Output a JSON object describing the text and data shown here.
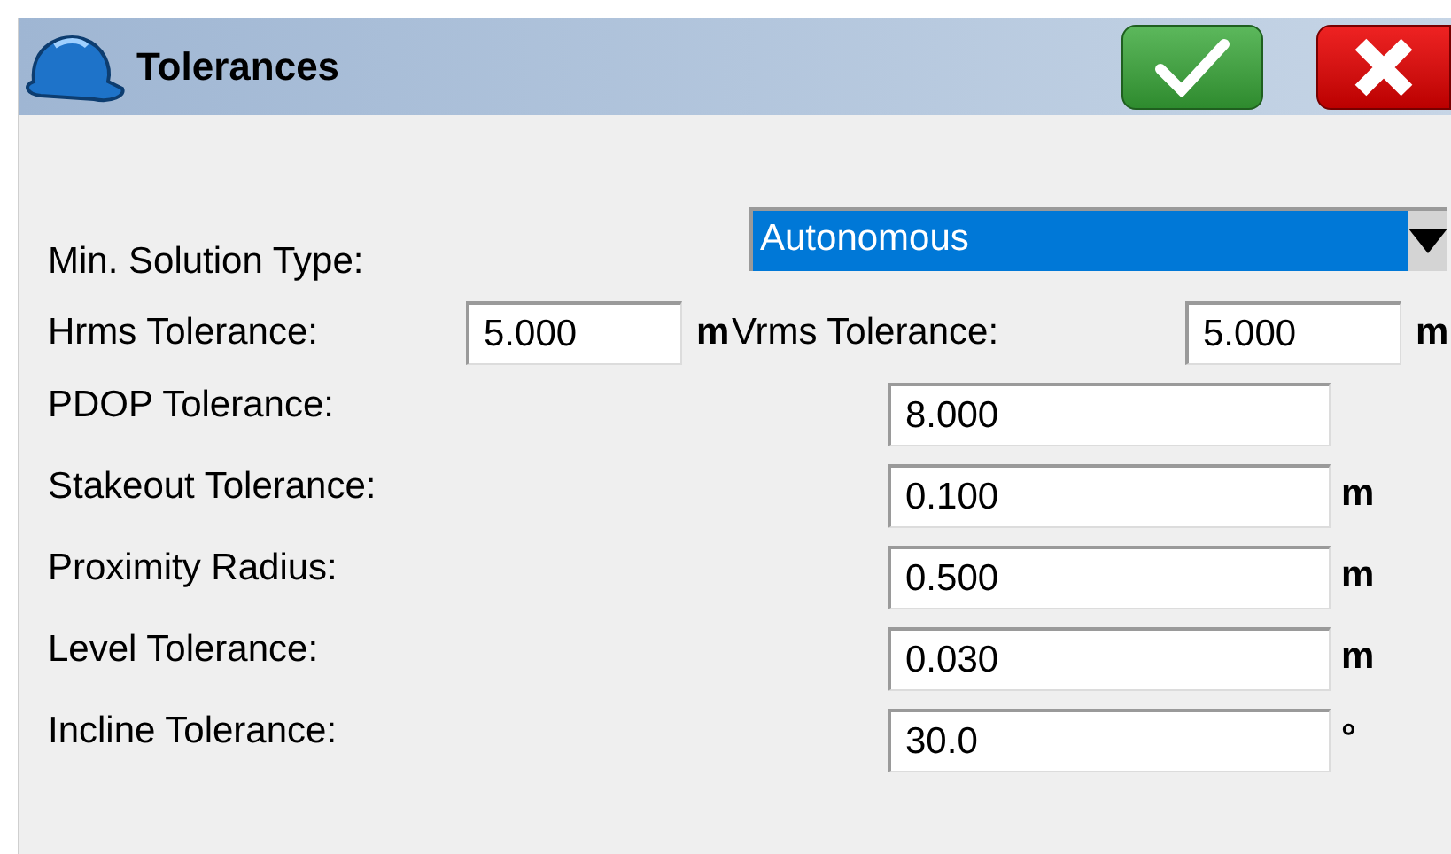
{
  "window": {
    "title": "Tolerances"
  },
  "solution_type": {
    "label": "Min. Solution Type:",
    "value": "Autonomous"
  },
  "rms": [
    {
      "label": "Hrms Tolerance:",
      "value": "5.000",
      "unit": "m"
    },
    {
      "label": "Vrms Tolerance:",
      "value": "5.000",
      "unit": "m"
    }
  ],
  "rows": [
    {
      "label": "PDOP Tolerance:",
      "value": "8.000"
    },
    {
      "label": "Stakeout Tolerance:",
      "value": "0.100",
      "unit": "m"
    },
    {
      "label": "Proximity Radius:",
      "value": "0.500",
      "unit": "m"
    },
    {
      "label": "Level Tolerance:",
      "value": "0.030",
      "unit": "m"
    },
    {
      "label": "Incline Tolerance:",
      "value": "30.0",
      "unit": "°"
    }
  ]
}
